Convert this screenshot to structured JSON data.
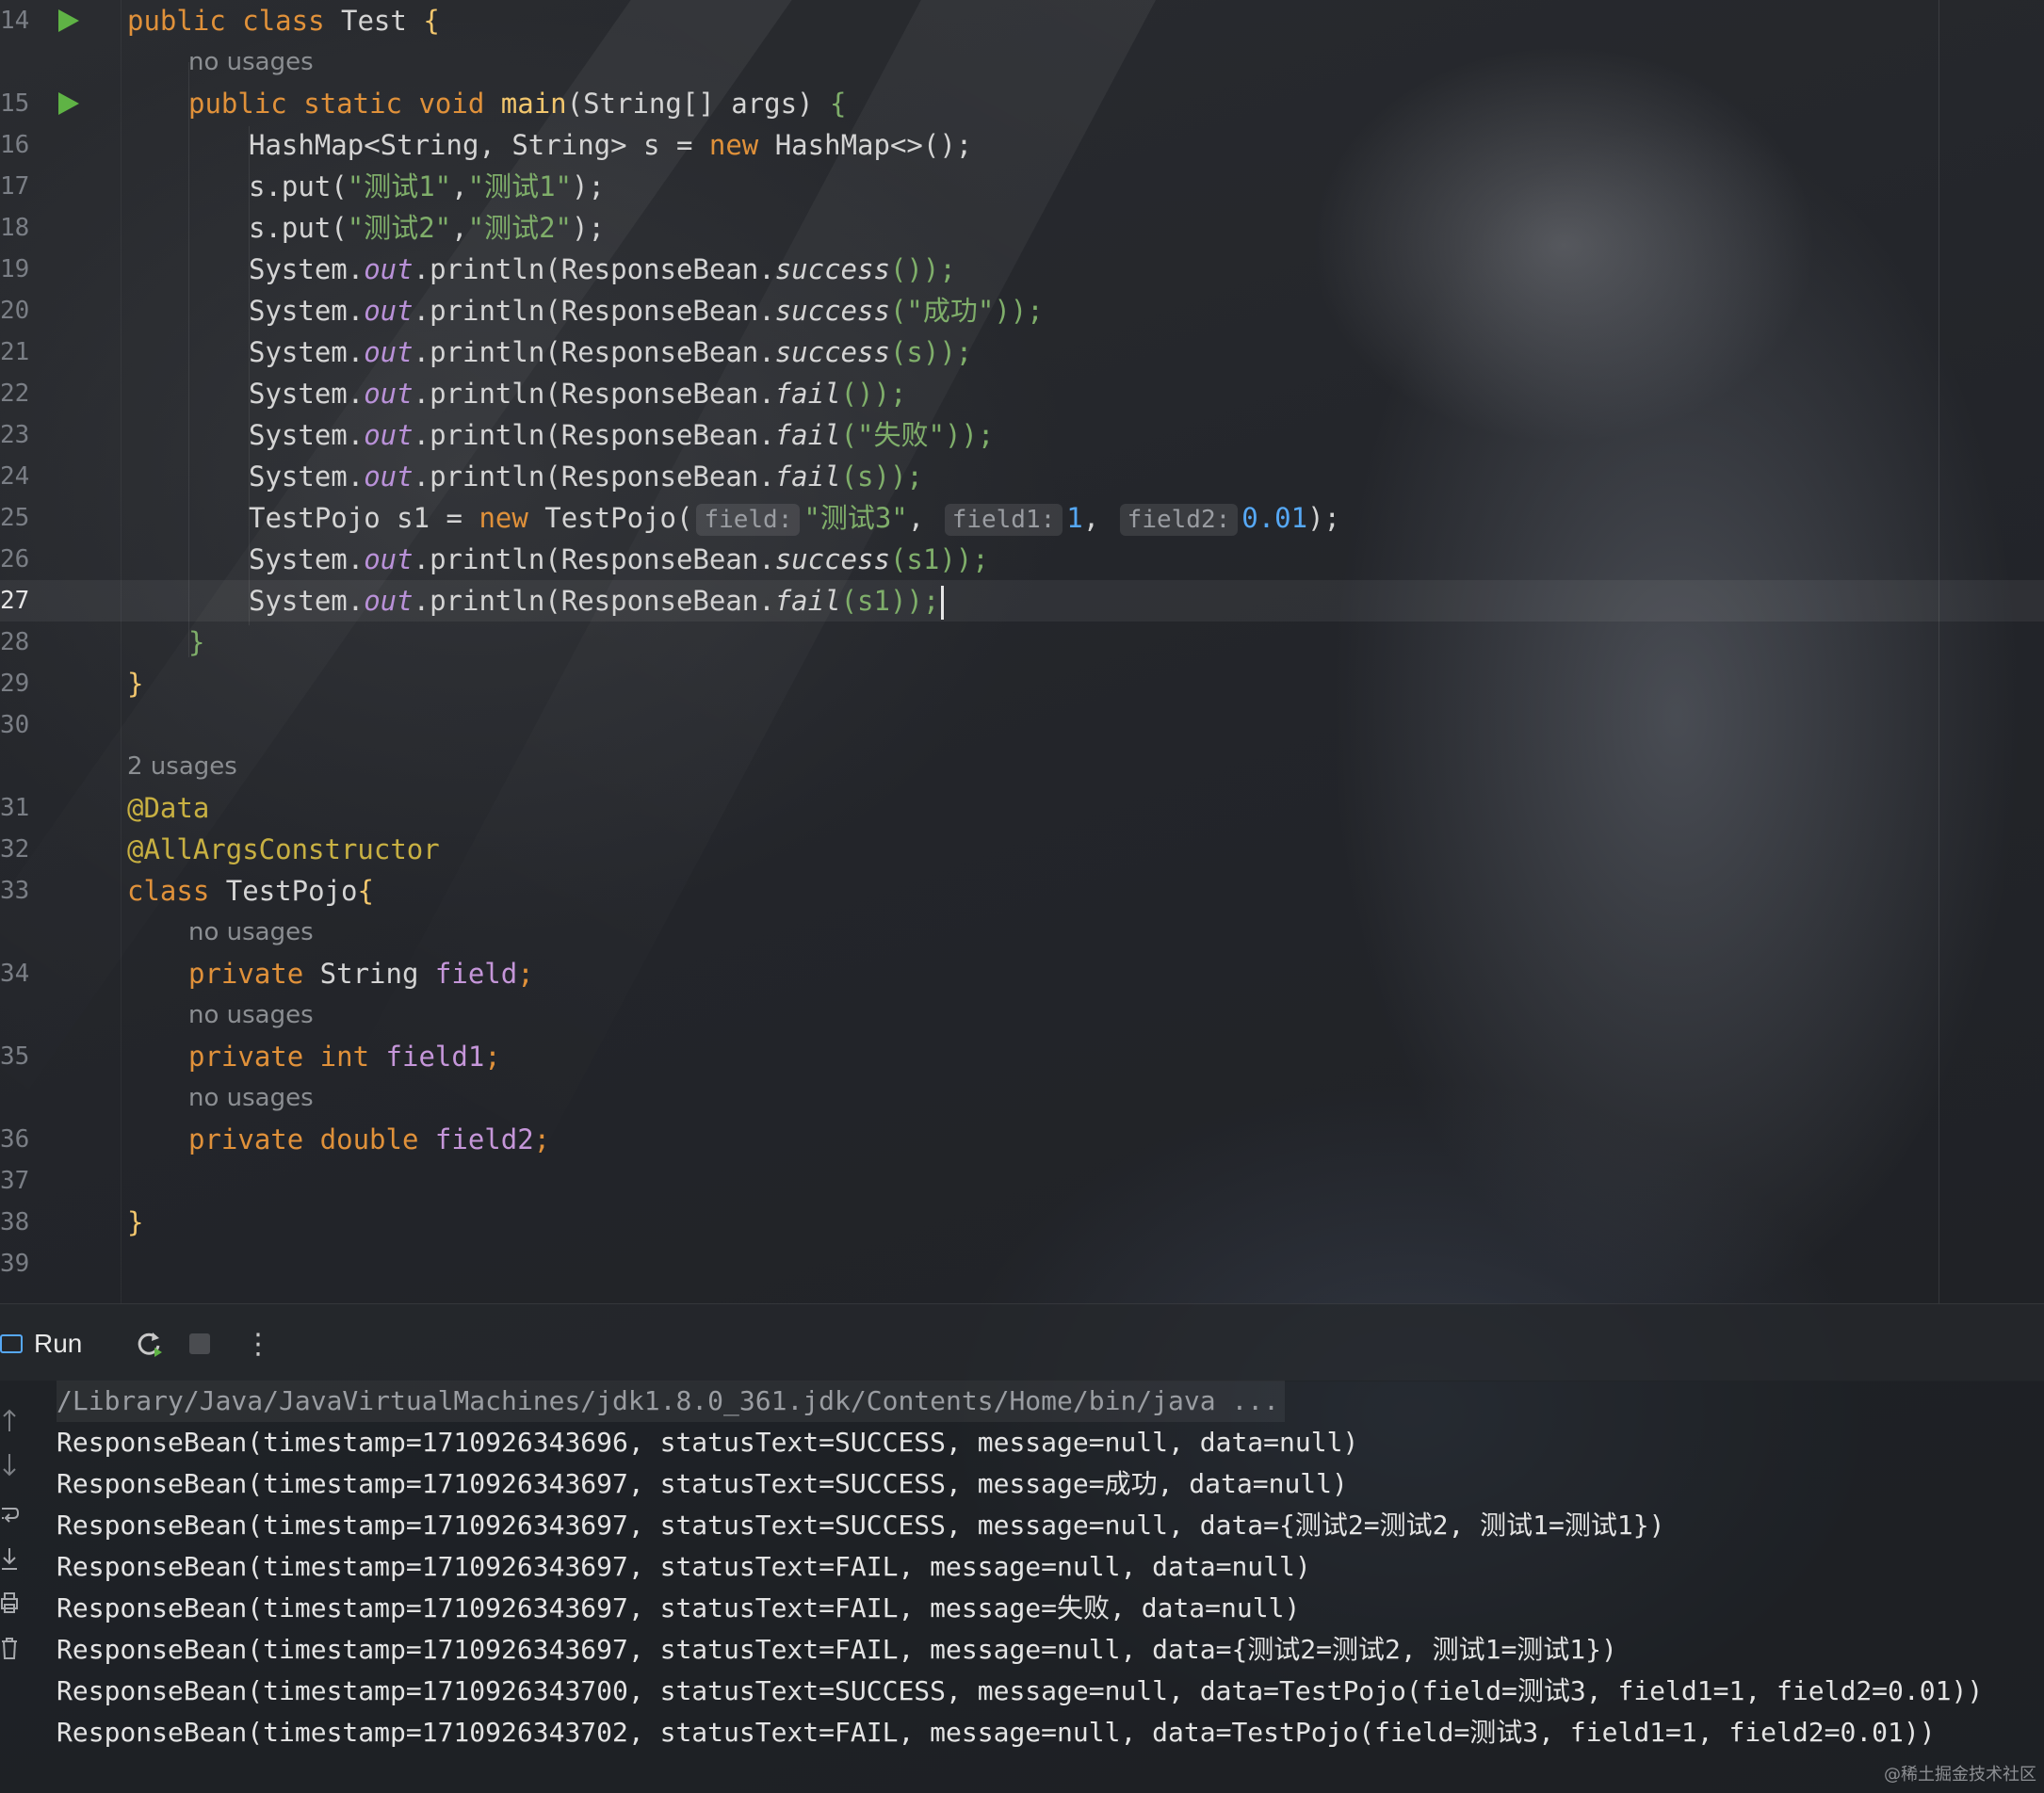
{
  "editor": {
    "lines": [
      {
        "n": "14"
      },
      {
        "n": "15"
      },
      {
        "n": "16"
      },
      {
        "n": "17"
      },
      {
        "n": "18"
      },
      {
        "n": "19"
      },
      {
        "n": "20"
      },
      {
        "n": "21"
      },
      {
        "n": "22"
      },
      {
        "n": "23"
      },
      {
        "n": "24"
      },
      {
        "n": "25"
      },
      {
        "n": "26"
      },
      {
        "n": "27"
      },
      {
        "n": "28"
      },
      {
        "n": "29"
      },
      {
        "n": "30"
      },
      {
        "n": "31"
      },
      {
        "n": "32"
      },
      {
        "n": "33"
      },
      {
        "n": "34"
      },
      {
        "n": "35"
      },
      {
        "n": "36"
      },
      {
        "n": "37"
      },
      {
        "n": "38"
      },
      {
        "n": "39"
      }
    ],
    "current_line": "27",
    "usage_hints": {
      "no_usages": "no usages",
      "two_usages": "2 usages"
    },
    "code": {
      "l14": {
        "kw1": "public",
        "kw2": "class",
        "name": "Test",
        "brace": "{"
      },
      "l15": {
        "kw1": "public",
        "kw2": "static",
        "kw3": "void",
        "fn": "main",
        "params": "(String[] args)",
        "brace": "{"
      },
      "l16": {
        "t1": "HashMap<String, String> s = ",
        "kw": "new",
        "t2": " HashMap<>();"
      },
      "l17": {
        "t1": "s.put(",
        "s1": "\"测试1\"",
        "c": ",",
        "s2": "\"测试1\"",
        "t2": ");"
      },
      "l18": {
        "t1": "s.put(",
        "s1": "\"测试2\"",
        "c": ",",
        "s2": "\"测试2\"",
        "t2": ");"
      },
      "l19": {
        "a": "System.",
        "b": "out",
        "c": ".println(ResponseBean.",
        "d": "success",
        "e": "());"
      },
      "l20": {
        "a": "System.",
        "b": "out",
        "c": ".println(ResponseBean.",
        "d": "success",
        "e1": "(",
        "s": "\"成功\"",
        "e2": "));"
      },
      "l21": {
        "a": "System.",
        "b": "out",
        "c": ".println(ResponseBean.",
        "d": "success",
        "e": "(s));"
      },
      "l22": {
        "a": "System.",
        "b": "out",
        "c": ".println(ResponseBean.",
        "d": "fail",
        "e": "());"
      },
      "l23": {
        "a": "System.",
        "b": "out",
        "c": ".println(ResponseBean.",
        "d": "fail",
        "e1": "(",
        "s": "\"失败\"",
        "e2": "));"
      },
      "l24": {
        "a": "System.",
        "b": "out",
        "c": ".println(ResponseBean.",
        "d": "fail",
        "e": "(s));"
      },
      "l25": {
        "t1": "TestPojo s1 = ",
        "kw": "new",
        "t2": " TestPojo(",
        "h1": "field:",
        "s": "\"测试3\"",
        "c1": ",",
        "h2": "field1:",
        "n1": "1",
        "c2": ",",
        "h3": "field2:",
        "n2": "0.01",
        "t3": ");"
      },
      "l26": {
        "a": "System.",
        "b": "out",
        "c": ".println(ResponseBean.",
        "d": "success",
        "e": "(s1));"
      },
      "l27": {
        "a": "System.",
        "b": "out",
        "c": ".println(ResponseBean.",
        "d": "fail",
        "e": "(s1));"
      },
      "l28": {
        "brace": "}"
      },
      "l29": {
        "brace": "}"
      },
      "l31": {
        "ann": "@Data"
      },
      "l32": {
        "ann": "@AllArgsConstructor"
      },
      "l33": {
        "kw": "class",
        "name": " TestPojo",
        "brace": "{"
      },
      "l34": {
        "kw": "private",
        "type": " String ",
        "field": "field",
        "semi": ";"
      },
      "l35": {
        "kw": "private",
        "type": " int ",
        "field": "field1",
        "semi": ";"
      },
      "l36": {
        "kw": "private",
        "type": " double ",
        "field": "field2",
        "semi": ";"
      },
      "l38": {
        "brace": "}"
      }
    }
  },
  "run_panel": {
    "tab_label": "Run",
    "toolbar": {
      "rerun_icon": "rerun-icon",
      "stop_icon": "stop-icon",
      "more_icon": "more-icon"
    },
    "output": [
      "/Library/Java/JavaVirtualMachines/jdk1.8.0_361.jdk/Contents/Home/bin/java ...",
      "ResponseBean(timestamp=1710926343696, statusText=SUCCESS, message=null, data=null)",
      "ResponseBean(timestamp=1710926343697, statusText=SUCCESS, message=成功, data=null)",
      "ResponseBean(timestamp=1710926343697, statusText=SUCCESS, message=null, data={测试2=测试2, 测试1=测试1})",
      "ResponseBean(timestamp=1710926343697, statusText=FAIL, message=null, data=null)",
      "ResponseBean(timestamp=1710926343697, statusText=FAIL, message=失败, data=null)",
      "ResponseBean(timestamp=1710926343697, statusText=FAIL, message=null, data={测试2=测试2, 测试1=测试1})",
      "ResponseBean(timestamp=1710926343700, statusText=SUCCESS, message=null, data=TestPojo(field=测试3, field1=1, field2=0.01))",
      "ResponseBean(timestamp=1710926343702, statusText=FAIL, message=null, data=TestPojo(field=测试3, field1=1, field2=0.01))"
    ]
  },
  "watermark": "@稀土掘金技术社区",
  "colors": {
    "keyword": "#e0913a",
    "function": "#f2c66d",
    "string": "#7fae6a",
    "number": "#56a8f5",
    "static_field": "#b991d8",
    "annotation": "#c8b042",
    "run_gutter": "#5fb345"
  }
}
